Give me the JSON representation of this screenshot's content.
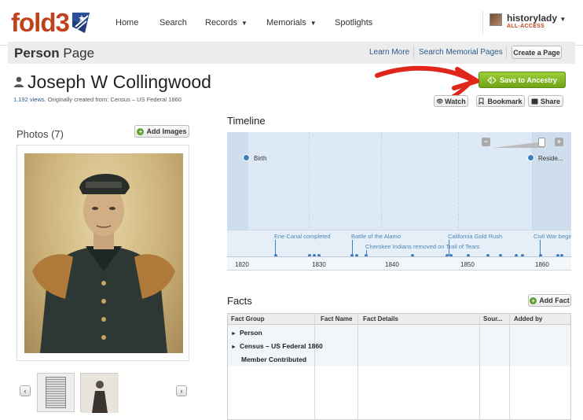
{
  "logo": {
    "text": "fold3"
  },
  "nav": {
    "home": "Home",
    "search": "Search",
    "records": "Records",
    "memorials": "Memorials",
    "spotlights": "Spotlights",
    "dropdown_glyph": "▼"
  },
  "user": {
    "name": "historylady",
    "subscription": "ALL-ACCESS"
  },
  "page_header": {
    "title_bold": "Person",
    "title_rest": " Page",
    "learn_more": "Learn More",
    "search_memorial": "Search Memorial Pages",
    "create_page": "Create a Page"
  },
  "person": {
    "name": "Joseph W Collingwood",
    "views": "1,192 views.",
    "origin": " Originally created from: Census – US Federal 1860"
  },
  "actions": {
    "save_to_ancestry": "Save to Ancestry",
    "watch": "Watch",
    "bookmark": "Bookmark",
    "share": "Share"
  },
  "photos": {
    "title": "Photos (7)",
    "add_images": "Add Images",
    "prev": "‹",
    "next": "›"
  },
  "timeline": {
    "title": "Timeline",
    "years": [
      "1820",
      "1830",
      "1840",
      "1850",
      "1860"
    ],
    "life_events": [
      "Birth",
      "Reside..."
    ],
    "history_events": [
      "Erie Canal completed",
      "Battle of the Alamo",
      "Cherokee Indians removed on Trail of Tears",
      "California Gold Rush",
      "Civil War begins"
    ],
    "zoom_out": "−",
    "zoom_in": "+"
  },
  "facts": {
    "title": "Facts",
    "add_fact": "Add Fact",
    "columns": [
      "Fact Group",
      "Fact Name",
      "Fact Details",
      "Sour...",
      "Added by"
    ],
    "rows": [
      "Person",
      "Census – US Federal 1860",
      "Member Contributed"
    ],
    "expand_glyph": "►"
  },
  "colors": {
    "brand": "#c0421c",
    "ancestry_green": "#7db321",
    "link_blue": "#2a5a8a",
    "timeline_bg": "#dde9f4"
  }
}
